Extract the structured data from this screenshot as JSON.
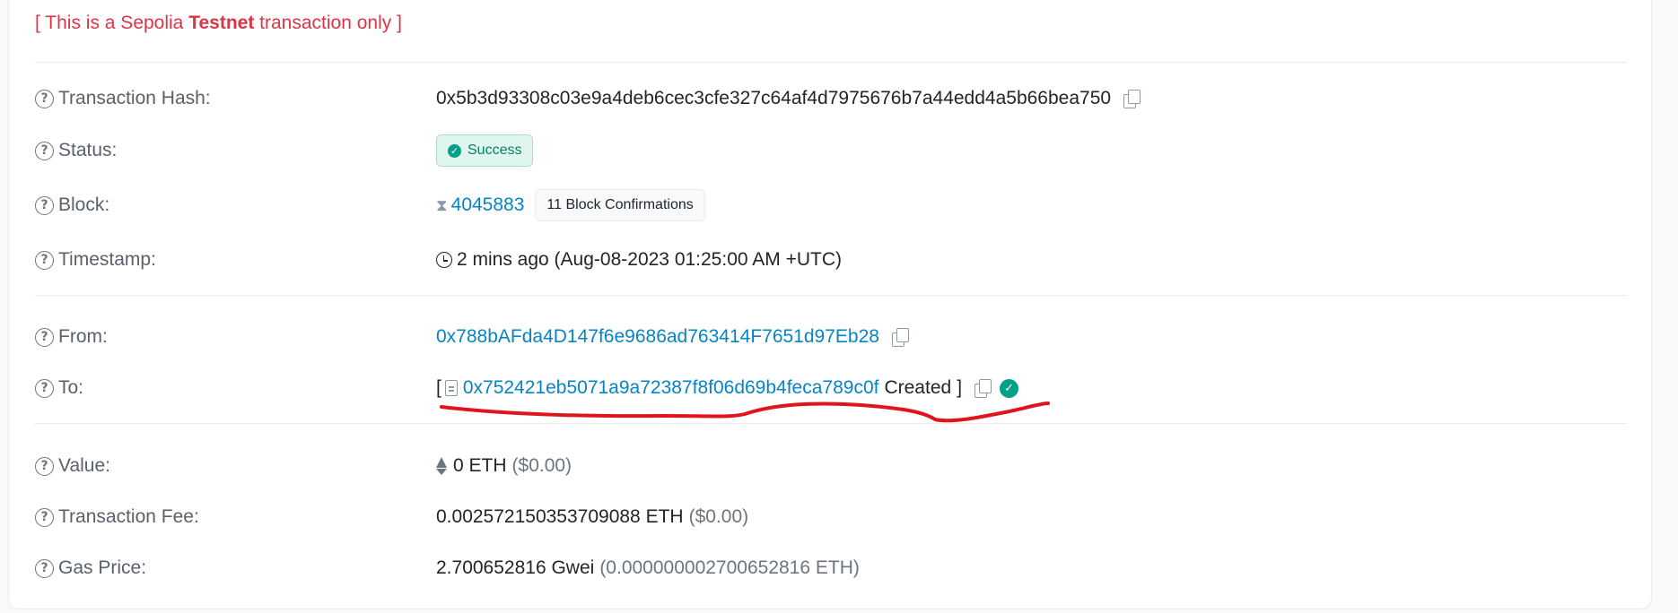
{
  "notice": {
    "prefix": "[ This is a Sepolia ",
    "bold": "Testnet",
    "suffix": " transaction only ]"
  },
  "rows": {
    "hash": {
      "label": "Transaction Hash:",
      "value": "0x5b3d93308c03e9a4deb6cec3cfe327c64af4d7975676b7a44edd4a5b66bea750"
    },
    "status": {
      "label": "Status:",
      "value": "Success"
    },
    "block": {
      "label": "Block:",
      "number": "4045883",
      "confirmations": "11 Block Confirmations"
    },
    "timestamp": {
      "label": "Timestamp:",
      "value": "2 mins ago (Aug-08-2023 01:25:00 AM +UTC)"
    },
    "from": {
      "label": "From:",
      "address": "0x788bAFda4D147f6e9686ad763414F7651d97Eb28"
    },
    "to": {
      "label": "To:",
      "open": "[",
      "address": "0x752421eb5071a9a72387f8f06d69b4feca789c0f",
      "created": "Created",
      "close": "]"
    },
    "value": {
      "label": "Value:",
      "amount": "0 ETH",
      "usd": "($0.00)"
    },
    "fee": {
      "label": "Transaction Fee:",
      "amount": "0.002572150353709088 ETH",
      "usd": "($0.00)"
    },
    "gas": {
      "label": "Gas Price:",
      "amount": "2.700652816 Gwei",
      "eth": "(0.000000002700652816 ETH)"
    }
  },
  "colors": {
    "notice": "#dc3545",
    "link": "#0784c3",
    "success": "#00a186",
    "annotation": "#e0141c"
  }
}
